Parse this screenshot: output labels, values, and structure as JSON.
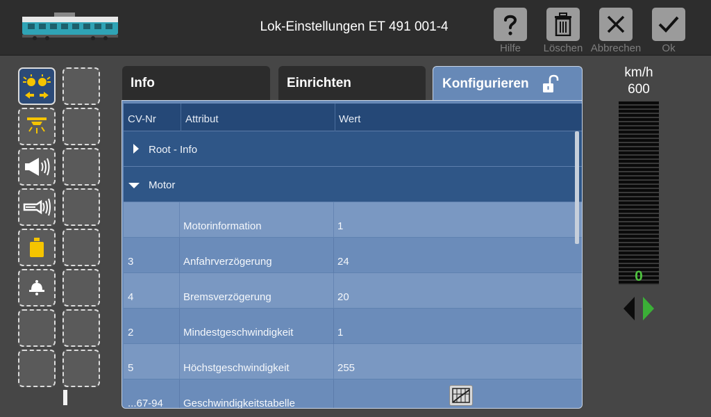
{
  "header": {
    "title": "Lok-Einstellungen ET 491 001-4",
    "buttons": [
      {
        "id": "help",
        "label": "Hilfe",
        "icon": "question-icon"
      },
      {
        "id": "delete",
        "label": "Löschen",
        "icon": "trash-icon"
      },
      {
        "id": "cancel",
        "label": "Abbrechen",
        "icon": "close-icon"
      },
      {
        "id": "ok",
        "label": "Ok",
        "icon": "check-icon"
      }
    ]
  },
  "functions": {
    "left": [
      {
        "icon": "headlights-icon",
        "active": true
      },
      {
        "icon": "interior-light-icon",
        "active": false
      },
      {
        "icon": "horn-sound-icon",
        "active": false
      },
      {
        "icon": "whistle-sound-icon",
        "active": false
      },
      {
        "icon": "weight-icon",
        "active": false
      },
      {
        "icon": "bell-icon",
        "active": false
      },
      {
        "icon": "",
        "active": false
      },
      {
        "icon": "",
        "active": false
      }
    ]
  },
  "tabs": [
    {
      "label": "Info",
      "active": false
    },
    {
      "label": "Einrichten",
      "active": false
    },
    {
      "label": "Konfigurieren",
      "active": true,
      "icon": "unlock-icon"
    }
  ],
  "table": {
    "columns": [
      "CV-Nr",
      "Attribut",
      "Wert"
    ],
    "groups": [
      {
        "label": "Root - Info",
        "expanded": false
      },
      {
        "label": "Motor",
        "expanded": true
      }
    ],
    "rows": [
      {
        "cv": "",
        "attr": "Motorinformation",
        "value": "1"
      },
      {
        "cv": "3",
        "attr": "Anfahrverzögerung",
        "value": "24"
      },
      {
        "cv": "4",
        "attr": "Bremsverzögerung",
        "value": "20"
      },
      {
        "cv": "2",
        "attr": "Mindestgeschwindigkeit",
        "value": "1"
      },
      {
        "cv": "5",
        "attr": "Höchstgeschwindigkeit",
        "value": "255"
      },
      {
        "cv": "...67-94",
        "attr": "Geschwindigkeitstabelle",
        "value": ""
      }
    ]
  },
  "speed": {
    "unit": "km/h",
    "max": "600",
    "current": "0",
    "direction": "forward"
  },
  "colors": {
    "accent_blue": "#254877",
    "speed_green": "#4fc23f",
    "function_yellow": "#f5c400"
  }
}
